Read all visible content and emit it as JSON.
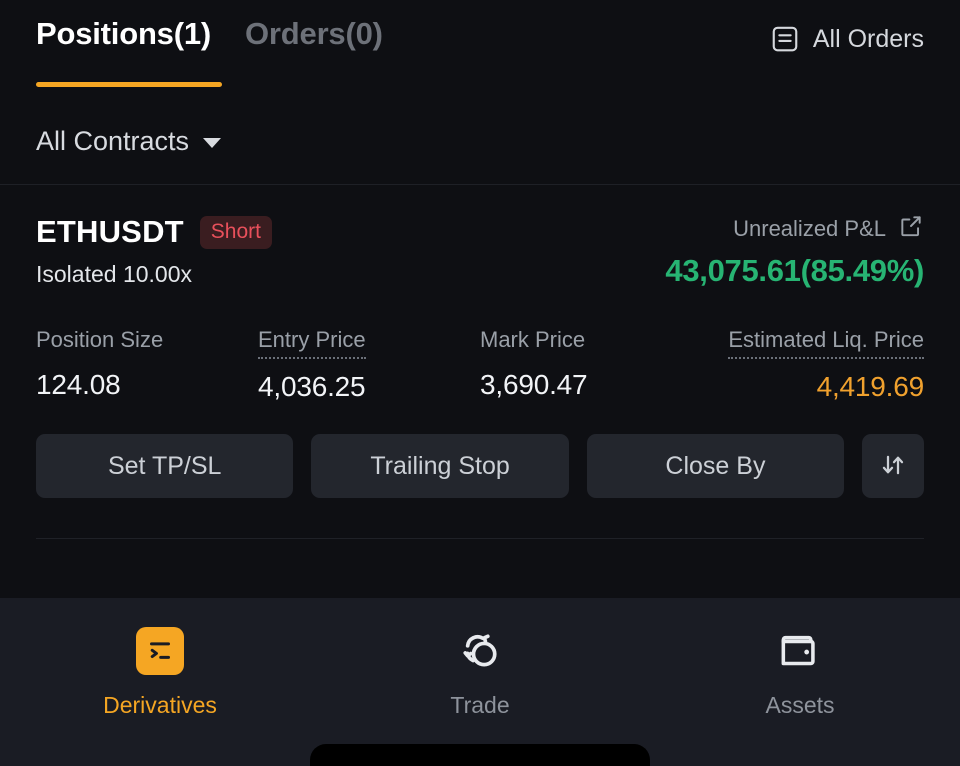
{
  "tabs": {
    "positions": "Positions(1)",
    "orders": "Orders(0)",
    "all_orders": "All Orders",
    "all_orders_icon": "list-document-icon",
    "active_accent": "#f5a623"
  },
  "filter": {
    "contracts_label": "All Contracts",
    "caret_icon": "chevron-down-icon"
  },
  "position": {
    "symbol": "ETHUSDT",
    "side": "Short",
    "side_color": "#e8505b",
    "margin_mode": "Isolated 10.00x",
    "pnl_label": "Unrealized P&L",
    "pnl_expand_icon": "external-link-icon",
    "pnl_value": "43,075.61(85.49%)",
    "pnl_color": "#27b473",
    "metrics": [
      {
        "label": "Position Size",
        "value": "124.08",
        "dotted": false,
        "align": "left",
        "warn": false
      },
      {
        "label": "Entry Price",
        "value": "4,036.25",
        "dotted": true,
        "align": "left",
        "warn": false
      },
      {
        "label": "Mark Price",
        "value": "3,690.47",
        "dotted": false,
        "align": "left",
        "warn": false
      },
      {
        "label": "Estimated Liq. Price",
        "value": "4,419.69",
        "dotted": true,
        "align": "right",
        "warn": true
      }
    ],
    "liq_price_color": "#f0a12e",
    "actions": {
      "set_tpsl": "Set TP/SL",
      "trailing_stop": "Trailing Stop",
      "close_by": "Close By",
      "reverse_icon": "arrows-up-down-icon"
    }
  },
  "bottom_nav": {
    "items": [
      {
        "label": "Derivatives",
        "icon": "derivatives-icon",
        "active": true
      },
      {
        "label": "Trade",
        "icon": "swap-circles-icon",
        "active": false
      },
      {
        "label": "Assets",
        "icon": "wallet-icon",
        "active": false
      }
    ]
  }
}
